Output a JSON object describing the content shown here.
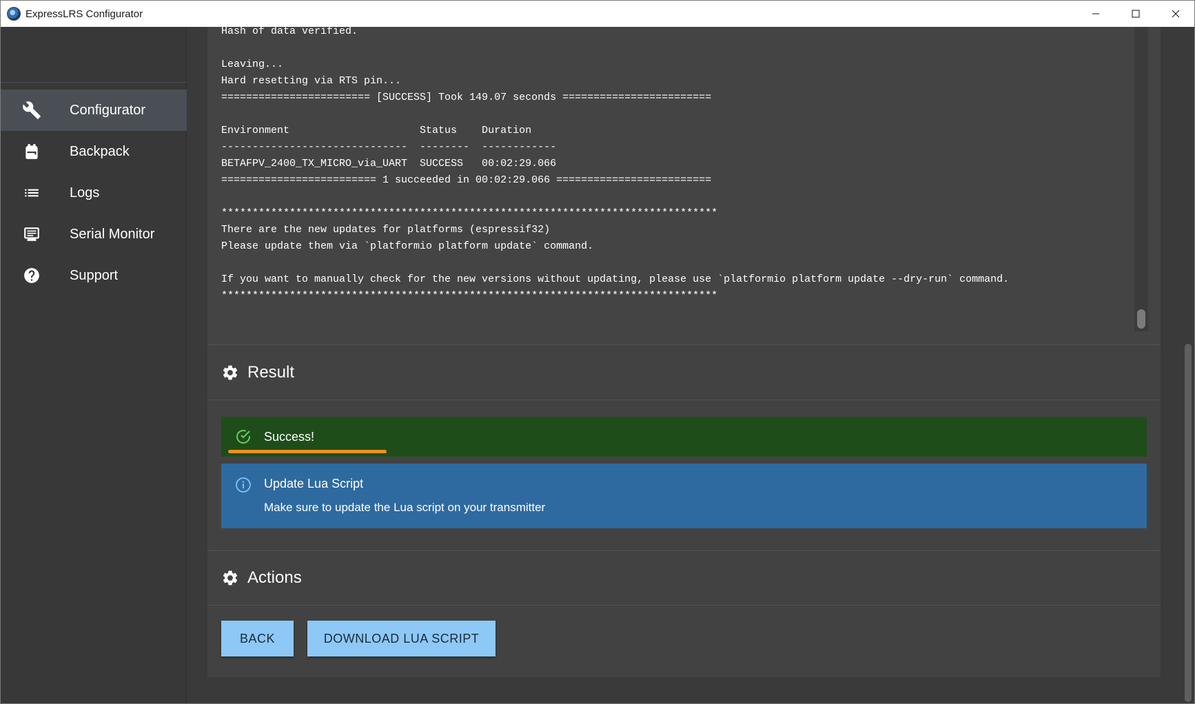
{
  "window": {
    "title": "ExpressLRS Configurator",
    "controls": {
      "minimize": "—",
      "maximize": "☐",
      "close": "✕"
    }
  },
  "sidebar": {
    "items": [
      {
        "label": "Configurator",
        "icon": "wrench-icon",
        "active": true
      },
      {
        "label": "Backpack",
        "icon": "backpack-icon",
        "active": false
      },
      {
        "label": "Logs",
        "icon": "list-icon",
        "active": false
      },
      {
        "label": "Serial Monitor",
        "icon": "monitor-icon",
        "active": false
      },
      {
        "label": "Support",
        "icon": "help-icon",
        "active": false
      }
    ]
  },
  "console": {
    "lines": [
      "Hash of data verified.",
      "",
      "Leaving...",
      "Hard resetting via RTS pin...",
      "======================== [SUCCESS] Took 149.07 seconds ========================",
      "",
      "Environment                     Status    Duration",
      "------------------------------  --------  ------------",
      "BETAFPV_2400_TX_MICRO_via_UART  SUCCESS   00:02:29.066",
      "========================= 1 succeeded in 00:02:29.066 =========================",
      "",
      "********************************************************************************",
      "There are the new updates for platforms (espressif32)",
      "Please update them via `platformio platform update` command.",
      "",
      "If you want to manually check for the new versions without updating, please use `platformio platform update --dry-run` command.",
      "********************************************************************************"
    ]
  },
  "result": {
    "heading": "Result",
    "success_text": "Success!",
    "info_title": "Update Lua Script",
    "info_text": "Make sure to update the Lua script on your transmitter"
  },
  "actions": {
    "heading": "Actions",
    "back_label": "BACK",
    "download_label": "DOWNLOAD LUA SCRIPT"
  },
  "colors": {
    "success_bg": "#1e4d1a",
    "info_bg": "#2e6aa0",
    "button_bg": "#8dc8f6",
    "progress": "#f0901e"
  }
}
